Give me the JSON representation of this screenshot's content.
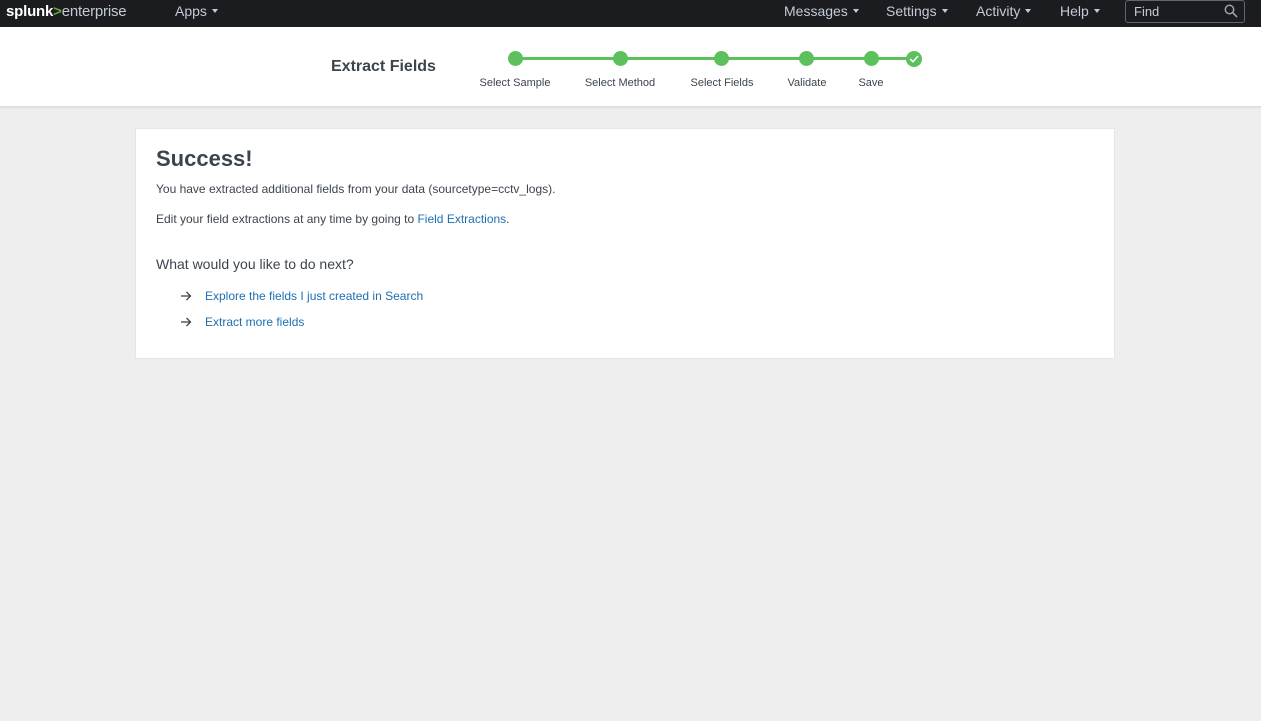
{
  "topbar": {
    "logo": {
      "brand": "splunk",
      "separator": ">",
      "product": "enterprise"
    },
    "apps_label": "Apps",
    "messages_label": "Messages",
    "settings_label": "Settings",
    "activity_label": "Activity",
    "help_label": "Help",
    "find_placeholder": "Find",
    "icons": {
      "dropdown": "caret-down-icon",
      "search": "search-icon"
    }
  },
  "wizard": {
    "title": "Extract Fields",
    "steps": [
      {
        "label": "Select Sample",
        "status": "complete"
      },
      {
        "label": "Select Method",
        "status": "complete"
      },
      {
        "label": "Select Fields",
        "status": "complete"
      },
      {
        "label": "Validate",
        "status": "complete"
      },
      {
        "label": "Save",
        "status": "complete"
      },
      {
        "label": "",
        "status": "done",
        "icon": "check-icon"
      }
    ],
    "accent_color": "#5cc05c"
  },
  "success": {
    "heading": "Success!",
    "message": "You have extracted additional fields from your data (sourcetype=cctv_logs).",
    "edit_prefix": "Edit your field extractions at any time by going to ",
    "edit_link": "Field Extractions",
    "edit_suffix": ".",
    "next_question": "What would you like to do next?",
    "next_actions": [
      {
        "label": "Explore the fields I just created in Search",
        "icon": "arrow-right-icon"
      },
      {
        "label": "Extract more fields",
        "icon": "arrow-right-icon"
      }
    ],
    "link_color": "#1e6fb3"
  }
}
